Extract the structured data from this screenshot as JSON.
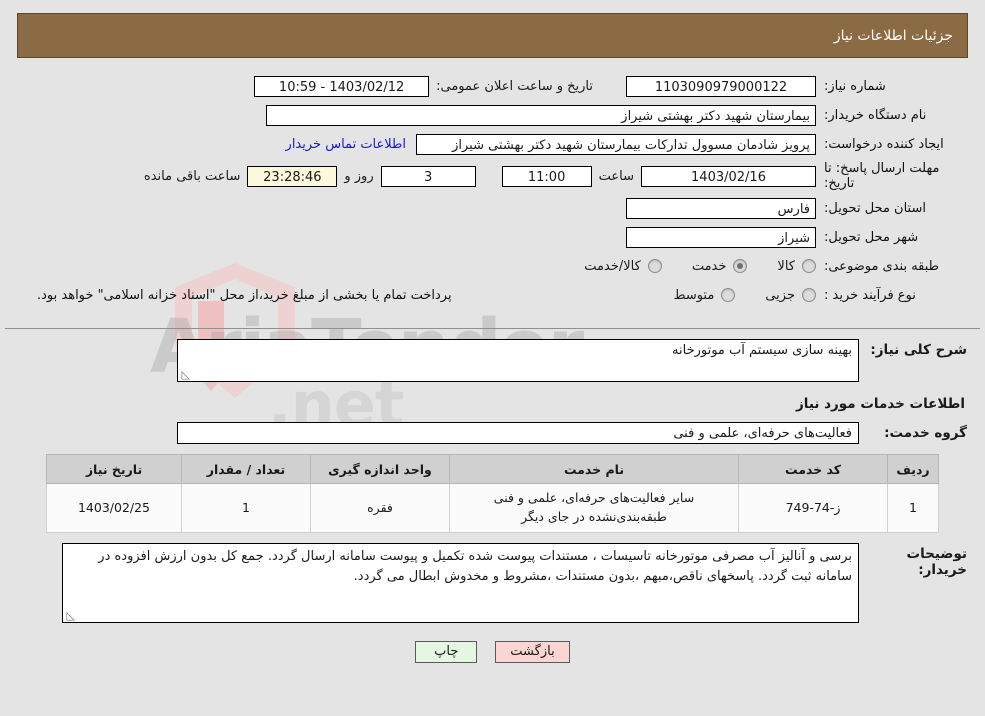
{
  "header": {
    "title": "جزئیات اطلاعات نیاز"
  },
  "info": {
    "need_number_label": "شماره نیاز:",
    "need_number_value": "1103090979000122",
    "public_announce_label": "تاریخ و ساعت اعلان عمومی:",
    "public_announce_value": "1403/02/12 - 10:59",
    "buyer_org_label": "نام دستگاه خریدار:",
    "buyer_org_value": "بیمارستان شهید دکتر بهشتی شیراز",
    "creator_label": "ایجاد کننده درخواست:",
    "creator_value": "پرویز شادمان مسوول تدارکات بیمارستان شهید دکتر بهشتی شیراز",
    "contact_link": "اطلاعات تماس خریدار",
    "deadline_label": "مهلت ارسال پاسخ: تا تاریخ:",
    "deadline_date": "1403/02/16",
    "deadline_hour_label": "ساعت",
    "deadline_time": "11:00",
    "remaining_days": "3",
    "remaining_days_label": "روز و",
    "remaining_clock": "23:28:46",
    "remaining_suffix": "ساعت باقی مانده",
    "province_label": "استان محل تحویل:",
    "province_value": "فارس",
    "city_label": "شهر محل تحویل:",
    "city_value": "شیراز",
    "category_label": "طبقه بندی موضوعی:",
    "category_options": [
      {
        "label": "کالا",
        "selected": false
      },
      {
        "label": "خدمت",
        "selected": true
      },
      {
        "label": "کالا/خدمت",
        "selected": false
      }
    ],
    "process_label": "نوع فرآیند خرید :",
    "process_options": [
      {
        "label": "جزیی",
        "selected": false
      },
      {
        "label": "متوسط",
        "selected": false
      }
    ],
    "payment_note": "پرداخت تمام یا بخشی از مبلغ خرید،از محل \"اسناد خزانه اسلامی\" خواهد بود."
  },
  "description": {
    "caption": "شرح کلی نیاز:",
    "value": "بهینه سازی سیستم آب موتورخانه"
  },
  "services_section": {
    "title": "اطلاعات خدمات مورد نیاز",
    "group_caption": "گروه خدمت:",
    "group_value": "فعالیت‌های حرفه‌ای، علمی و فنی"
  },
  "table": {
    "columns": [
      "ردیف",
      "کد خدمت",
      "نام خدمت",
      "واحد اندازه گیری",
      "تعداد / مقدار",
      "تاریخ نیاز"
    ],
    "rows": [
      {
        "row_no": "1",
        "code": "ز-74-749",
        "name": "سایر فعالیت‌های حرفه‌ای، علمی و فنی طبقه‌بندی‌نشده در جای دیگر",
        "unit": "فقره",
        "quantity": "1",
        "need_date": "1403/02/25"
      }
    ]
  },
  "buyer_notes": {
    "caption": "توضیحات خریدار:",
    "value": "برسی و آنالیز آب مصرفی موتورخانه تاسیسات ، مستندات پیوست شده تکمیل و پیوست سامانه ارسال گردد. جمع کل بدون ارزش افزوده در سامانه ثبت گردد. پاسخهای ناقص،مبهم ،بدون مستندات ،مشروط و مخدوش ابطال می گردد."
  },
  "footer": {
    "print_label": "چاپ",
    "back_label": "بازگشت"
  },
  "watermark": {
    "text": "AriaTender",
    "text2": ".net"
  }
}
